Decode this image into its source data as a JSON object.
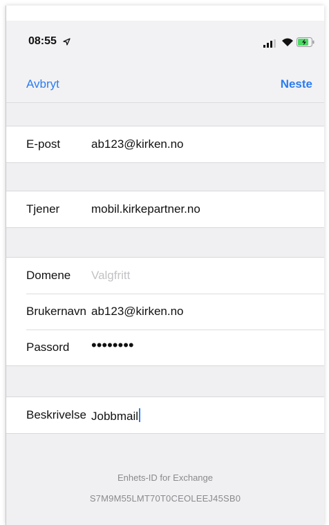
{
  "status_bar": {
    "time": "08:55",
    "icons": [
      "location-arrow-icon",
      "signal-icon",
      "wifi-icon",
      "battery-charging-icon"
    ]
  },
  "nav": {
    "cancel_label": "Avbryt",
    "next_label": "Neste"
  },
  "account": {
    "email_label": "E-post",
    "email_value": "ab123@kirken.no"
  },
  "server": {
    "server_label": "Tjener",
    "server_value": "mobil.kirkepartner.no"
  },
  "credentials": {
    "domain_label": "Domene",
    "domain_placeholder": "Valgfritt",
    "username_label": "Brukernavn",
    "username_value": "ab123@kirken.no",
    "password_label": "Passord",
    "password_value": "••••••••"
  },
  "description": {
    "label": "Beskrivelse",
    "value": "Jobbmail"
  },
  "footer": {
    "device_id_title": "Enhets-ID for Exchange",
    "device_id": "S7M9M55LMT70T0CEOLEEJ45SB0"
  },
  "colors": {
    "accent": "#2b7cf2",
    "background": "#f0f0f2",
    "battery": "#4cd964"
  }
}
